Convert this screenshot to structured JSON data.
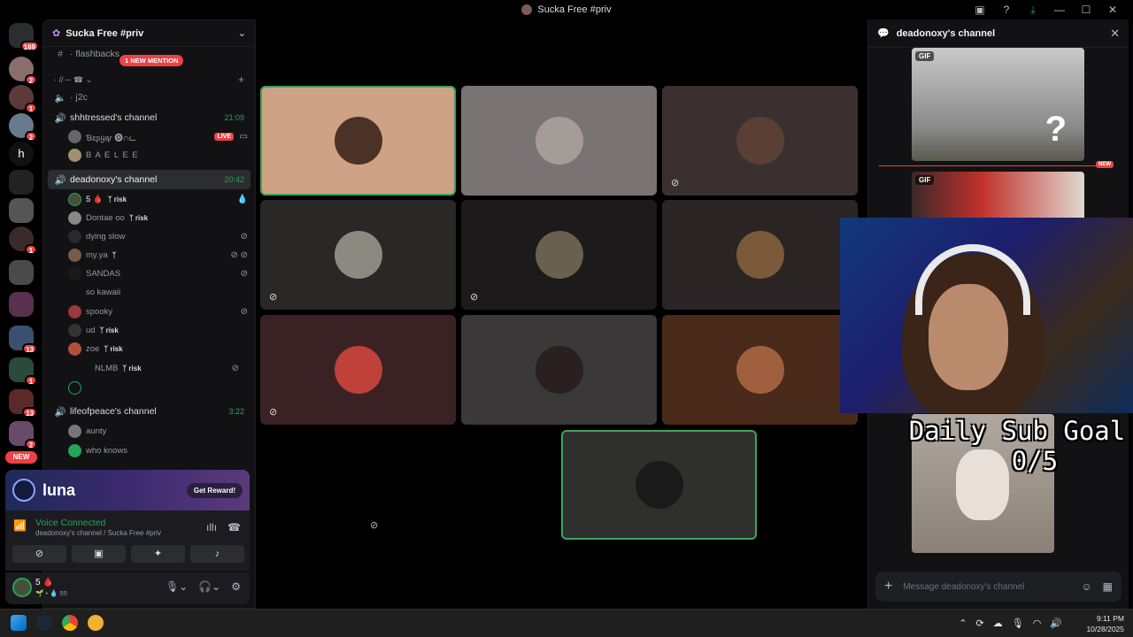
{
  "window": {
    "title": "Sucka Free #priv"
  },
  "rail": {
    "home_badge": "169",
    "new_label": "NEW",
    "letter_server": "h",
    "badges": [
      "2",
      "1",
      "2",
      "1",
      "13",
      "1",
      "13",
      "2"
    ]
  },
  "sidebar": {
    "server_name": "Sucka Free #priv",
    "mention_pill": "1 NEW MENTION",
    "channels": {
      "flashbacks": "· flashbacks",
      "category": "· // ─ ☎ ⌄",
      "j2c": "· j2c",
      "shhtressed": {
        "name": "shhtressed's channel",
        "time": "21:09"
      },
      "deadonoxy": {
        "name": "deadonoxy's channel",
        "time": "20:42"
      },
      "lifeofpeace": {
        "name": "lifeofpeace's channel",
        "time": "3:22"
      }
    },
    "shhtressed_users": [
      {
        "name": "Ɓɛʂყąɾ 🅞∩ᓚ",
        "live": "LIVE"
      },
      {
        "name": "B A E L E E"
      }
    ],
    "deadonoxy_users": [
      {
        "name": "5 🩸",
        "tag": "ᛉ risk"
      },
      {
        "name": "Dontae oo",
        "tag": "ᛉ risk"
      },
      {
        "name": "dying slow"
      },
      {
        "name": "my.ya",
        "tag": "ᛉ"
      },
      {
        "name": "SANDAS"
      },
      {
        "name": "so kawaii"
      },
      {
        "name": "spooky"
      },
      {
        "name": "ud",
        "tag": "ᛉ risk"
      },
      {
        "name": "zoe",
        "tag": "ᛉ risk"
      },
      {
        "name": "NLMB",
        "tag": "ᛉ risk"
      }
    ],
    "lifeofpeace_users": [
      {
        "name": "aunty"
      },
      {
        "name": "who knows"
      }
    ]
  },
  "promo": {
    "brand": "luna",
    "button": "Get Reward!"
  },
  "voice": {
    "status": "Voice Connected",
    "channel": "deadonoxy's channel / Sucka Free #priv"
  },
  "user_panel": {
    "name": "5 🩸",
    "status": "🌱 • 💧 55"
  },
  "chat": {
    "title": "deadonoxy's channel",
    "gif_label": "GIF",
    "new_label": "NEW",
    "input_placeholder": "Message deadonoxy's channel"
  },
  "overlay": {
    "goal_title": "Daily Sub Goal",
    "goal_count": "0/5"
  },
  "taskbar": {
    "time": "9:11 PM",
    "date": "10/28/2025"
  },
  "colors": {
    "accent_green": "#23a55a",
    "danger_red": "#ed4245",
    "speaking_border": "#3ba55d"
  }
}
